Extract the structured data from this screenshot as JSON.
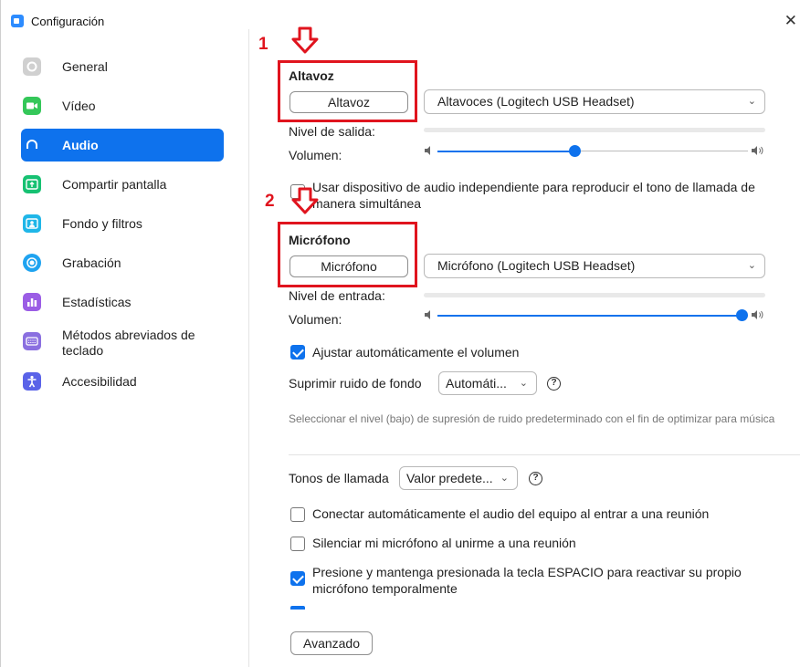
{
  "window": {
    "title": "Configuración",
    "close_glyph": "✕"
  },
  "sidebar": {
    "items": [
      {
        "label": "General",
        "icon": "gear-icon",
        "color": "#cfcfcf"
      },
      {
        "label": "Vídeo",
        "icon": "video-icon",
        "color": "#34c759"
      },
      {
        "label": "Audio",
        "icon": "headphones-icon",
        "color": "#0e72ed"
      },
      {
        "label": "Compartir pantalla",
        "icon": "share-screen-icon",
        "color": "#16c172"
      },
      {
        "label": "Fondo y filtros",
        "icon": "background-icon",
        "color": "#1fb6e8"
      },
      {
        "label": "Grabación",
        "icon": "record-icon",
        "color": "#1fa3f0"
      },
      {
        "label": "Estadísticas",
        "icon": "stats-icon",
        "color": "#9b5de5"
      },
      {
        "label": "Métodos abreviados de teclado",
        "icon": "keyboard-icon",
        "color": "#8a6fe0"
      },
      {
        "label": "Accesibilidad",
        "icon": "accessibility-icon",
        "color": "#5a63e8"
      }
    ],
    "active_index": 2
  },
  "annotations": {
    "marker_1": "1",
    "marker_2": "2",
    "color": "#e0141e"
  },
  "speaker": {
    "heading": "Altavoz",
    "test_button": "Altavoz",
    "device": "Altavoces (Logitech USB Headset)",
    "output_level_label": "Nivel de salida:",
    "volume_label": "Volumen:",
    "volume_fraction": 0.44
  },
  "separate_device": {
    "checked": false,
    "label": "Usar dispositivo de audio independiente para reproducir el tono de llamada de manera simultánea"
  },
  "microphone": {
    "heading": "Micrófono",
    "test_button": "Micrófono",
    "device": "Micrófono (Logitech USB Headset)",
    "input_level_label": "Nivel de entrada:",
    "volume_label": "Volumen:",
    "volume_fraction": 1.0
  },
  "auto_volume": {
    "checked": true,
    "label": "Ajustar automáticamente el volumen"
  },
  "noise": {
    "label": "Suprimir ruido de fondo",
    "value": "Automáti...",
    "hint": "Seleccionar el nivel (bajo) de supresión de ruido predeterminado con el fin de optimizar para música"
  },
  "ringtones": {
    "label": "Tonos de llamada",
    "value": "Valor predete..."
  },
  "options": [
    {
      "checked": false,
      "label": "Conectar automáticamente el audio del equipo al entrar a una reunión"
    },
    {
      "checked": false,
      "label": "Silenciar mi micrófono al unirme a una reunión"
    },
    {
      "checked": true,
      "label": "Presione y mantenga presionada la tecla ESPACIO para reactivar su propio micrófono temporalmente"
    }
  ],
  "advanced_button": "Avanzado",
  "help_glyph": "?",
  "chevron_glyph": "⌄",
  "accent": "#0e72ed"
}
